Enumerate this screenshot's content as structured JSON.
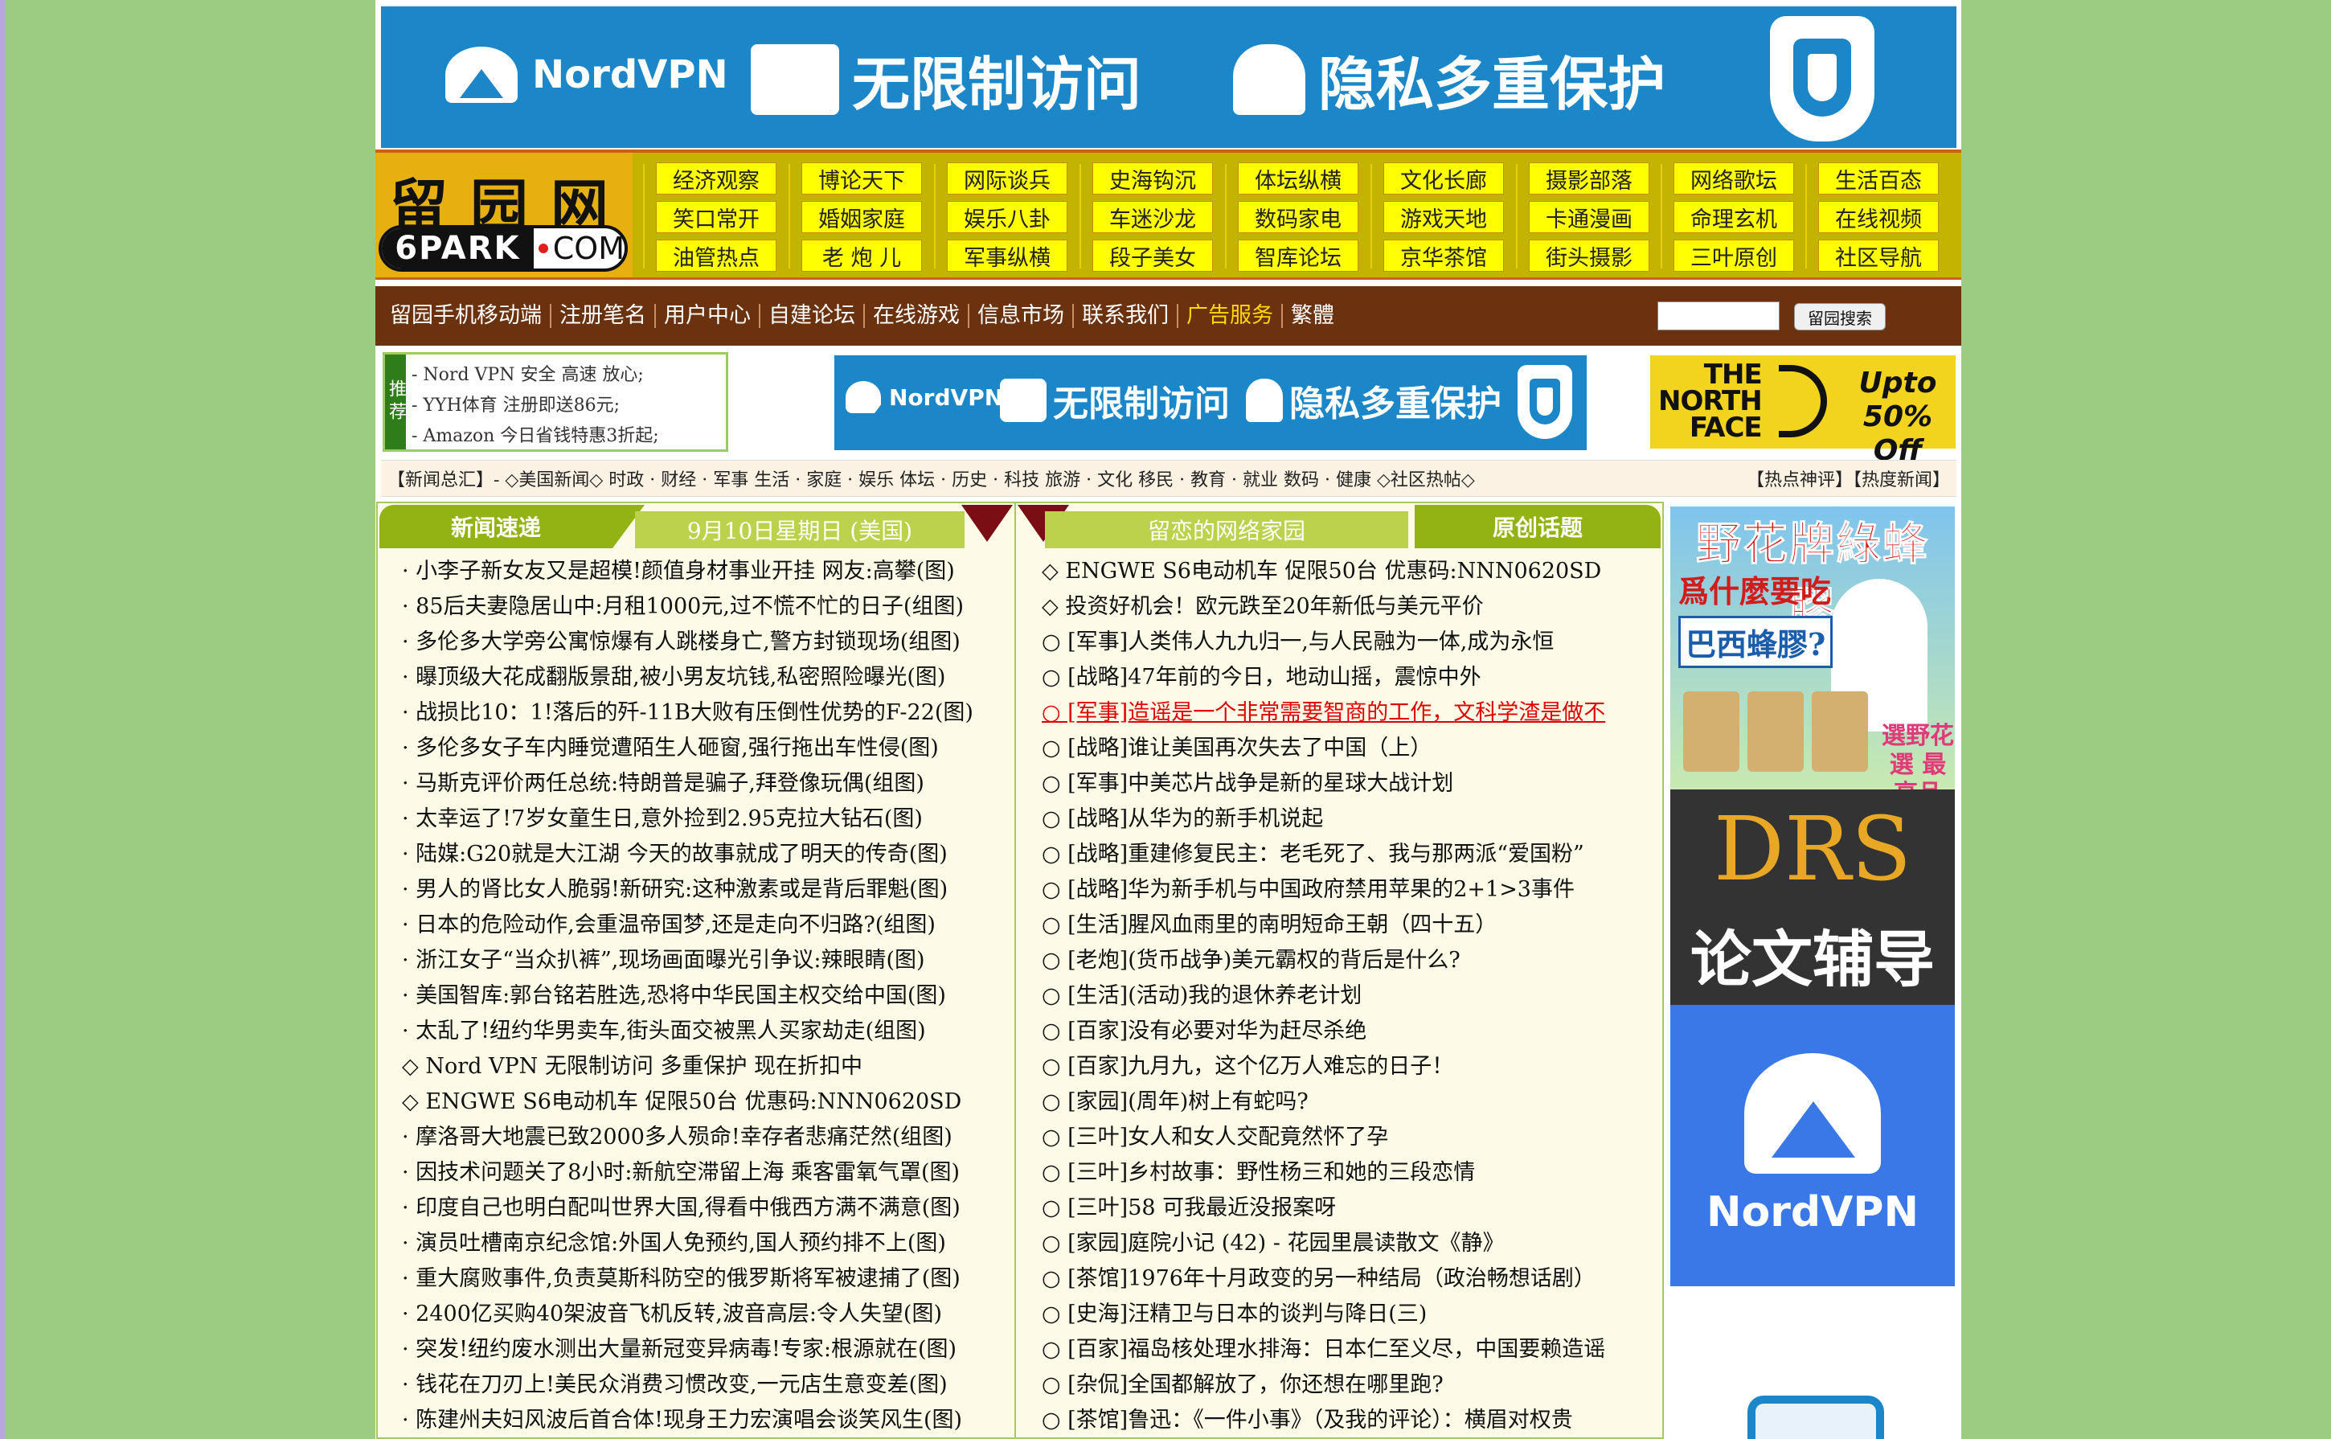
{
  "top_banner": {
    "brand": "NordVPN",
    "slogan1": "无限制访问",
    "slogan2": "隐私多重保护"
  },
  "logo": {
    "cn": "留园网",
    "en_dark": "6PARK",
    "en_com": "COM"
  },
  "categories": [
    [
      "经济观察",
      "博论天下",
      "网际谈兵",
      "史海钩沉",
      "体坛纵横",
      "文化长廊",
      "摄影部落",
      "网络歌坛",
      "生活百态"
    ],
    [
      "笑口常开",
      "婚姻家庭",
      "娱乐八卦",
      "车迷沙龙",
      "数码家电",
      "游戏天地",
      "卡通漫画",
      "命理玄机",
      "在线视频"
    ],
    [
      "油管热点",
      "老 炮 儿",
      "军事纵横",
      "段子美女",
      "智库论坛",
      "京华茶馆",
      "街头摄影",
      "三叶原创",
      "社区导航"
    ]
  ],
  "link_bar": [
    "留园手机移动端",
    "注册笔名",
    "用户中心",
    "自建论坛",
    "在线游戏",
    "信息市场",
    "联系我们",
    "广告服务",
    "繁體"
  ],
  "search": {
    "button": "留园搜索",
    "placeholder": ""
  },
  "recommend": {
    "tag": "推荐",
    "lines": [
      "- Nord VPN 安全 高速 放心;",
      "- YYH体育 注册即送86元;",
      "- Amazon 今日省钱特惠3折起;"
    ]
  },
  "mid_banner": {
    "brand": "NordVPN",
    "slogan1": "无限制访问",
    "slogan2": "隐私多重保护"
  },
  "north_face": {
    "name": "THE NORTH FACE",
    "offer": "Upto 50% Off"
  },
  "ticker": {
    "left": "【新闻总汇】- ◇美国新闻◇ 时政 · 财经 · 军事 生活 · 家庭 · 娱乐 体坛 · 历史 · 科技 旅游 · 文化 移民 · 教育 · 就业 数码 · 健康 ◇社区热帖◇",
    "right": "【热点神评】【热度新闻】"
  },
  "col1": {
    "title": "新闻速递",
    "date": "9月10日星期日 (美国)",
    "items": [
      "· 小李子新女友又是超模!颜值身材事业开挂 网友:高攀(图)",
      "· 85后夫妻隐居山中:月租1000元,过不慌不忙的日子(组图)",
      "· 多伦多大学旁公寓惊爆有人跳楼身亡,警方封锁现场(组图)",
      "· 曝顶级大花成翻版景甜,被小男友坑钱,私密照险曝光(图)",
      "· 战损比10：1!落后的歼-11B大败有压倒性优势的F-22(图)",
      "· 多伦多女子车内睡觉遭陌生人砸窗,强行拖出车性侵(图)",
      "· 马斯克评价两任总统:特朗普是骗子,拜登像玩偶(组图)",
      "· 太幸运了!7岁女童生日,意外捡到2.95克拉大钻石(图)",
      "· 陆媒:G20就是大江湖 今天的故事就成了明天的传奇(图)",
      "· 男人的肾比女人脆弱!新研究:这种激素或是背后罪魁(图)",
      "· 日本的危险动作,会重温帝国梦,还是走向不归路?(组图)",
      "· 浙江女子“当众扒裤”,现场画面曝光引争议:辣眼睛(图)",
      "· 美国智库:郭台铭若胜选,恐将中华民国主权交给中国(图)",
      "· 太乱了!纽约华男卖车,街头面交被黑人买家劫走(组图)",
      "◇ Nord VPN 无限制访问 多重保护 现在折扣中",
      "◇ ENGWE S6电动机车 促限50台 优惠码:NNN0620SD",
      "· 摩洛哥大地震已致2000多人殒命!幸存者悲痛茫然(组图)",
      "· 因技术问题关了8小时:新航空滞留上海 乘客雷氧气罩(图)",
      "· 印度自己也明白配叫世界大国,得看中俄西方满不满意(图)",
      "· 演员吐槽南京纪念馆:外国人免预约,国人预约排不上(图)",
      "· 重大腐败事件,负责莫斯科防空的俄罗斯将军被逮捕了(图)",
      "· 2400亿买购40架波音飞机反转,波音高层:令人失望(图)",
      "· 突发!纽约废水测出大量新冠变异病毒!专家:根源就在(图)",
      "· 钱花在刀刃上!美民众消费习惯改变,一元店生意变差(图)",
      "· 陈建州夫妇风波后首合体!现身王力宏演唱会谈笑风生(图)"
    ]
  },
  "col2": {
    "title": "留恋的网络家园",
    "tab": "原创话题",
    "items": [
      "◇ ENGWE S6电动机车 促限50台 优惠码:NNN0620SD",
      "◇ 投资好机会！欧元跌至20年新低与美元平价",
      "○ [军事]人类伟人九九归一,与人民融为一体,成为永恒",
      "○ [战略]47年前的今日，地动山摇，震惊中外",
      "○ [军事]造谣是一个非常需要智商的工作，文科学渣是做不",
      "○ [战略]谁让美国再次失去了中国（上）",
      "○ [军事]中美芯片战争是新的星球大战计划",
      "○ [战略]从华为的新手机说起",
      "○ [战略]重建修复民主：老毛死了、我与那两派“爱国粉”",
      "○ [战略]华为新手机与中国政府禁用苹果的2+1>3事件",
      "○ [生活]腥风血雨里的南明短命王朝（四十五）",
      "○ [老炮](货币战争)美元霸权的背后是什么?",
      "○ [生活](活动)我的退休养老计划",
      "○ [百家]没有必要对华为赶尽杀绝",
      "○ [百家]九月九，这个亿万人难忘的日子！",
      "○ [家园](周年)树上有蛇吗?",
      "○ [三叶]女人和女人交配竟然怀了孕",
      "○ [三叶]乡村故事：野性杨三和她的三段恋情",
      "○ [三叶]58 可我最近没报案呀",
      "○ [家园]庭院小记 (42) - 花园里晨读散文《静》",
      "○ [茶馆]1976年十月政变的另一种结局（政治畅想话剧）",
      "○ [史海]汪精卫与日本的谈判与降日(三)",
      "○ [百家]福岛核处理水排海：日本仁至义尽，中国要赖造谣",
      "○ [杂侃]全国都解放了，你还想在哪里跑?",
      "○ [茶馆]鲁迅：《一件小事》（及我的评论）：横眉对权贵"
    ],
    "highlight_index": 4
  },
  "right_ads": {
    "honey": {
      "title": "野花牌綠蜂膠",
      "q1": "爲什麼要吃",
      "q2": "巴西蜂膠?",
      "slogan": "選野花選 最高品質!"
    },
    "drs": {
      "brand": "DRS",
      "text": "论文辅导"
    },
    "nord": {
      "brand": "NordVPN"
    }
  }
}
